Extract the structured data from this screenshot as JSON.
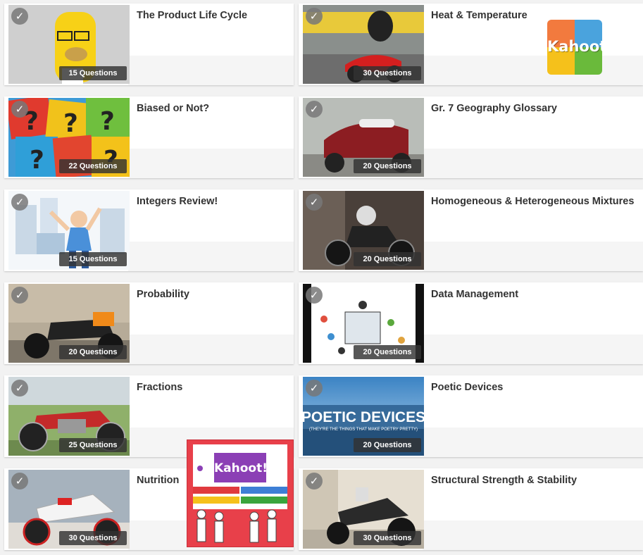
{
  "colors": {
    "badge_bg": "#333333",
    "check_bg": "#787878",
    "kahoot_orange": "#f27a3e",
    "kahoot_blue": "#4aa3dd",
    "kahoot_yellow": "#f5c11b",
    "kahoot_green": "#6aba3b",
    "kahoot_purple": "#8b3fb5"
  },
  "check_glyph": "✓",
  "logo": {
    "text": "Kahoot!"
  },
  "overlay": {
    "text": "Kahoot!"
  },
  "cards": [
    {
      "title": "The Product Life Cycle",
      "questions": "15 Questions",
      "thumb_icon": "cartoon-character-icon"
    },
    {
      "title": "Heat & Temperature",
      "questions": "30 Questions",
      "thumb_icon": "scooter-rider-icon"
    },
    {
      "title": "Biased or Not?",
      "questions": "22 Questions",
      "thumb_icon": "question-marks-icon"
    },
    {
      "title": "Gr. 7 Geography Glossary",
      "questions": "20 Questions",
      "thumb_icon": "red-scooter-icon"
    },
    {
      "title": "Integers Review!",
      "questions": "15 Questions",
      "thumb_icon": "cartoon-man-icon"
    },
    {
      "title": "Homogeneous & Heterogeneous Mixtures",
      "questions": "20 Questions",
      "thumb_icon": "motorcycle-photo-icon"
    },
    {
      "title": "Probability",
      "questions": "20 Questions",
      "thumb_icon": "orange-motorbike-icon"
    },
    {
      "title": "Data Management",
      "questions": "20 Questions",
      "thumb_icon": "data-illustration-icon"
    },
    {
      "title": "Fractions",
      "questions": "25 Questions",
      "thumb_icon": "cafe-racer-icon"
    },
    {
      "title": "Poetic Devices",
      "questions": "20 Questions",
      "thumb_icon": "poetic-devices-banner-icon",
      "thumb_text": "POETIC DEVICES",
      "thumb_subtext": "(THEY'RE THE THINGS THAT MAKE POETRY PRETTY)"
    },
    {
      "title": "Nutrition",
      "questions": "30 Questions",
      "thumb_icon": "white-motorbike-icon"
    },
    {
      "title": "Structural Strength & Stability",
      "questions": "30 Questions",
      "thumb_icon": "black-motorbike-icon"
    }
  ]
}
